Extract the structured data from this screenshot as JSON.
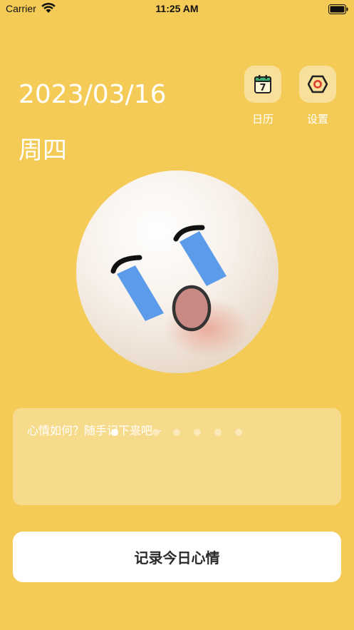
{
  "status_bar": {
    "carrier": "Carrier",
    "time": "11:25 AM"
  },
  "header": {
    "date": "2023/03/16",
    "weekday": "周四"
  },
  "actions": {
    "calendar_label": "日历",
    "calendar_icon_number": "7",
    "settings_label": "设置"
  },
  "mood_entry": {
    "placeholder": "心情如何？随手记下来吧~",
    "page_count": 7,
    "active_page": 1
  },
  "record_button": {
    "label": "记录今日心情"
  },
  "colors": {
    "background": "#F5CB58",
    "card": "#F7DB8D",
    "icon_button_bg": "#F8E09A",
    "tear_blue": "#5B9BEA",
    "mouth": "#C98A86"
  }
}
